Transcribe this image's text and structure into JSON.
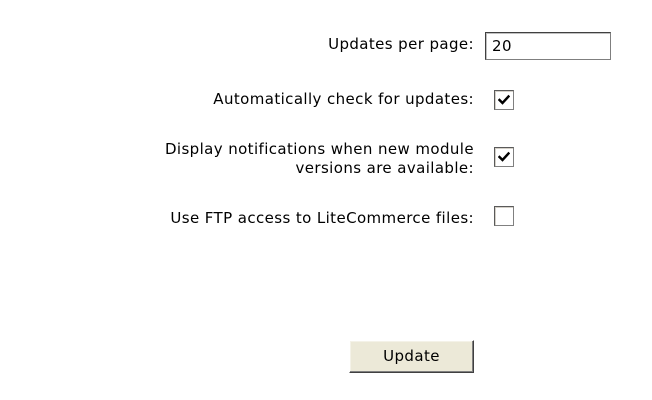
{
  "settings": {
    "updates_per_page": {
      "label": "Updates per page:",
      "value": "20"
    },
    "auto_check": {
      "label": "Automatically check for updates:",
      "checked": true
    },
    "notifications": {
      "label_line1": "Display notifications when new module",
      "label_line2": "versions are available:",
      "checked": true
    },
    "ftp_access": {
      "label": "Use FTP access to LiteCommerce files:",
      "checked": false
    }
  },
  "actions": {
    "update_label": "Update"
  },
  "icons": {
    "check": "checkmark-icon"
  }
}
